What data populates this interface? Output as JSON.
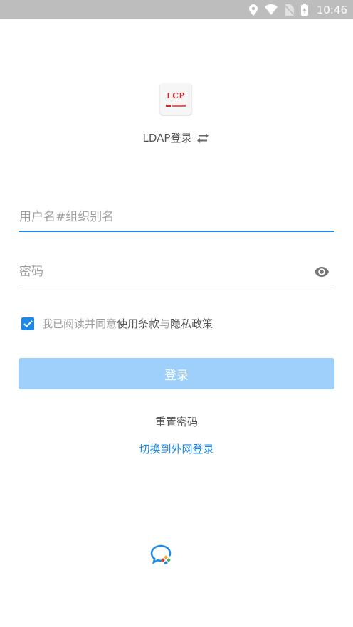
{
  "status_bar": {
    "time": "10:46",
    "icons": [
      "location-icon",
      "wifi-icon",
      "no-sim-icon",
      "battery-charging-icon"
    ]
  },
  "logo": {
    "text": "LCP"
  },
  "login_mode": {
    "label": "LDAP登录",
    "icon": "swap-icon"
  },
  "username": {
    "placeholder": "用户名#组织别名",
    "value": ""
  },
  "password": {
    "placeholder": "密码",
    "value": "",
    "toggle_icon": "eye-icon"
  },
  "agreement": {
    "checked": true,
    "prefix": "我已阅读并同意",
    "terms": "使用条款",
    "and": "与",
    "privacy": "隐私政策"
  },
  "login_button": {
    "label": "登录"
  },
  "reset_password": {
    "label": "重置密码"
  },
  "switch_login": {
    "label": "切换到外网登录"
  },
  "colors": {
    "accent": "#1e88e5",
    "button_disabled": "#9fd0fb",
    "status_bar": "#bdbdbd",
    "logo_red": "#c62828"
  }
}
